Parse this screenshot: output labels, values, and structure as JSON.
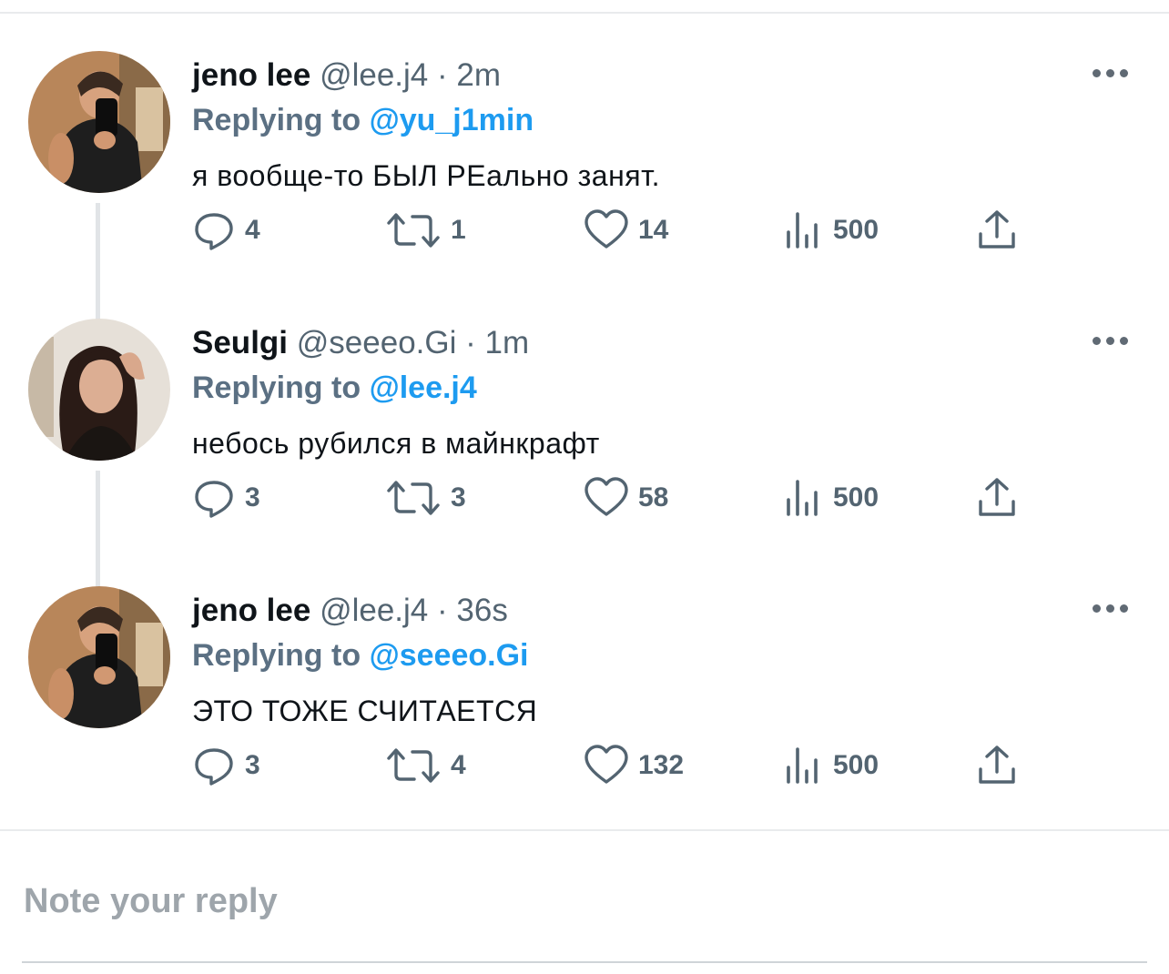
{
  "thread": [
    {
      "avatar": "jeno-avatar",
      "name": "jeno lee",
      "handle": "@lee.j4",
      "sep": "·",
      "time": "2m",
      "reply_label": "Replying to",
      "reply_to": "@yu_j1min",
      "text": "я вообще-то БЫЛ РЕально занят.",
      "replies": "4",
      "retweets": "1",
      "likes": "14",
      "views": "500"
    },
    {
      "avatar": "seulgi-avatar",
      "name": "Seulgi",
      "handle": "@seeeo.Gi",
      "sep": "·",
      "time": "1m",
      "reply_label": "Replying to",
      "reply_to": "@lee.j4",
      "text": "небось рубился в майнкрафт",
      "replies": "3",
      "retweets": "3",
      "likes": "58",
      "views": "500"
    },
    {
      "avatar": "jeno-avatar",
      "name": "jeno lee",
      "handle": "@lee.j4",
      "sep": "·",
      "time": "36s",
      "reply_label": "Replying to",
      "reply_to": "@seeeo.Gi",
      "text": "ЭТО ТОЖЕ СЧИТАЕТСЯ",
      "replies": "3",
      "retweets": "4",
      "likes": "132",
      "views": "500"
    }
  ],
  "compose": {
    "placeholder": "Note your reply"
  },
  "colors": {
    "accent": "#1d9bf0",
    "muted": "#536471",
    "text": "#0f1419"
  }
}
